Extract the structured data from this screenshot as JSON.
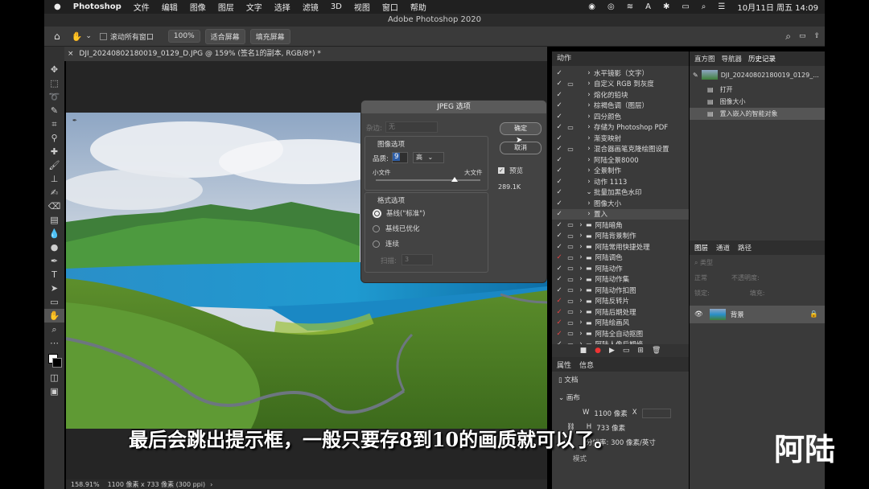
{
  "menubar": {
    "app": "Photoshop",
    "items": [
      "文件",
      "编辑",
      "图像",
      "图层",
      "文字",
      "选择",
      "滤镜",
      "3D",
      "视图",
      "窗口",
      "帮助"
    ],
    "clock": "10月11日 周五  14:09"
  },
  "window_title": "Adobe Photoshop 2020",
  "options": {
    "scroll_all": "滚动所有窗口",
    "zoom": "100%",
    "fit_screen": "适合屏幕",
    "fill_screen": "填充屏幕"
  },
  "doc_tab": "DJI_20240802180019_0129_D.JPG @ 159% (签名1的副本, RGB/8*) *",
  "status": {
    "zoom": "158.91%",
    "size": "1100 像素 x 733 像素 (300 ppi)"
  },
  "dialog": {
    "title": "JPEG 选项",
    "matte_label": "杂边:",
    "matte_value": "无",
    "image_options": "图像选项",
    "quality_label": "品质:",
    "quality_value": "9",
    "quality_level": "高",
    "small_file": "小文件",
    "large_file": "大文件",
    "slider_fraction": 0.75,
    "format_options": "格式选项",
    "format_baseline": "基线(\"标准\")",
    "format_optimized": "基线已优化",
    "format_progressive": "连续",
    "scans_label": "扫描:",
    "scans_value": "3",
    "ok": "确定",
    "cancel": "取消",
    "preview": "预览",
    "file_size": "289.1K"
  },
  "actions_panel": {
    "tab": "动作",
    "rows": [
      "水平镜影（文字）",
      "自定义 RGB 到灰度",
      "熔化的铅块",
      "棕褐色调（图层）",
      "四分颜色",
      "存储为 Photoshop PDF",
      "渐变映射",
      "混合器画笔克隆绘图设置",
      "阿陆全景8000",
      "全景制作",
      "动作 1113",
      "批量加黑色水印",
      "图像大小",
      "置入",
      "阿陆暗角",
      "阿陆背景制作",
      "阿陆常用快捷处理",
      "阿陆调色",
      "阿陆动作",
      "阿陆动作集",
      "阿陆动作扣图",
      "阿陆反转片",
      "阿陆后期处理",
      "阿陆绘画风",
      "阿陆全自动抠图",
      "阿陆人像后期修"
    ]
  },
  "properties_panel": {
    "tab1": "属性",
    "tab2": "信息",
    "doc": "文档",
    "canvas": "画布",
    "w_label": "W",
    "w_value": "1100 像素",
    "x_label": "X",
    "h_label": "H",
    "h_value": "733 像素",
    "resolution": "分辨率: 300 像素/英寸",
    "mode": "模式"
  },
  "history_panel": {
    "tabs": [
      "直方图",
      "导航器",
      "历史记录"
    ],
    "snapshot": "DJI_20240802180019_0129_...",
    "items": [
      "打开",
      "图像大小",
      "置入嵌入的智能对象"
    ]
  },
  "layers_panel": {
    "tabs": [
      "图层",
      "通道",
      "路径"
    ],
    "kind": "类型",
    "blend": "正常",
    "opacity": "不透明度:",
    "lock": "锁定:",
    "fill": "填充:",
    "layer_name": "背景"
  },
  "subtitle": "最后会跳出提示框，一般只要存8到10的画质就可以了。",
  "watermark": "阿陆"
}
